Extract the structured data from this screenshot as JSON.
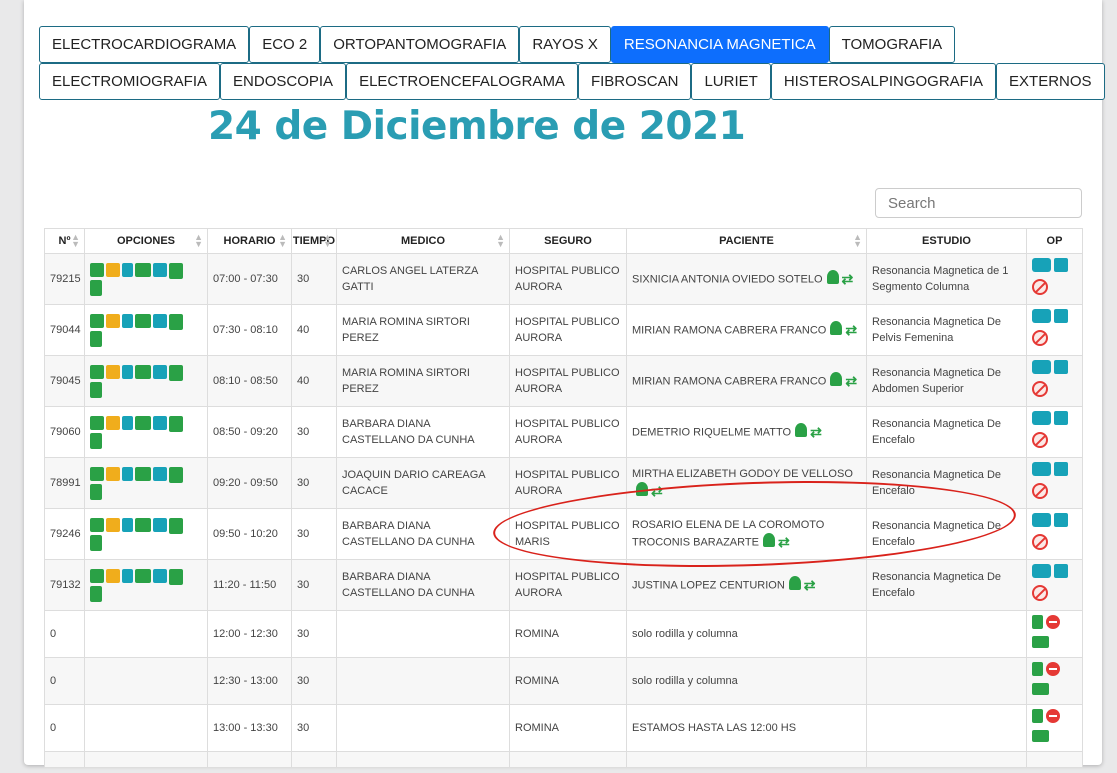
{
  "tabs_row1": [
    "ELECTROCARDIOGRAMA",
    "ECO 2",
    "ORTOPANTOMOGRAFIA",
    "RAYOS X",
    "RESONANCIA MAGNETICA",
    "TOMOGRAFIA"
  ],
  "tabs_row2": [
    "ELECTROMIOGRAFIA",
    "ENDOSCOPIA",
    "ELECTROENCEFALOGRAMA",
    "FIBROSCAN",
    "LURIET",
    "HISTEROSALPINGOGRAFIA",
    "EXTERNOS"
  ],
  "active_tab": "RESONANCIA MAGNETICA",
  "date_title": "24 de Diciembre de 2021",
  "search": {
    "placeholder": "Search"
  },
  "columns": [
    "Nº",
    "OPCIONES",
    "HORARIO",
    "TIEMPO",
    "MEDICO",
    "SEGURO",
    "PACIENTE",
    "ESTUDIO",
    "OP"
  ],
  "rows": [
    {
      "n": "79215",
      "horario": "07:00 - 07:30",
      "tiempo": "30",
      "medico": "CARLOS ANGEL LATERZA GATTI",
      "seguro": "HOSPITAL PUBLICO AURORA",
      "paciente": "SIXNICIA ANTONIA OVIEDO SOTELO",
      "estudio": "Resonancia Magnetica de 1 Segmento Columna"
    },
    {
      "n": "79044",
      "horario": "07:30 - 08:10",
      "tiempo": "40",
      "medico": "MARIA ROMINA SIRTORI PEREZ",
      "seguro": "HOSPITAL PUBLICO AURORA",
      "paciente": "MIRIAN RAMONA CABRERA FRANCO",
      "estudio": "Resonancia Magnetica De Pelvis Femenina"
    },
    {
      "n": "79045",
      "horario": "08:10 - 08:50",
      "tiempo": "40",
      "medico": "MARIA ROMINA SIRTORI PEREZ",
      "seguro": "HOSPITAL PUBLICO AURORA",
      "paciente": "MIRIAN RAMONA CABRERA FRANCO",
      "estudio": "Resonancia Magnetica De Abdomen Superior"
    },
    {
      "n": "79060",
      "horario": "08:50 - 09:20",
      "tiempo": "30",
      "medico": "BARBARA DIANA CASTELLANO DA CUNHA",
      "seguro": "HOSPITAL PUBLICO AURORA",
      "paciente": "DEMETRIO RIQUELME MATTO",
      "estudio": "Resonancia Magnetica De Encefalo"
    },
    {
      "n": "78991",
      "horario": "09:20 - 09:50",
      "tiempo": "30",
      "medico": "JOAQUIN DARIO CAREAGA CACACE",
      "seguro": "HOSPITAL PUBLICO AURORA",
      "paciente": "MIRTHA ELIZABETH GODOY DE VELLOSO",
      "estudio": "Resonancia Magnetica De Encefalo"
    },
    {
      "n": "79246",
      "horario": "09:50 - 10:20",
      "tiempo": "30",
      "medico": "BARBARA DIANA CASTELLANO DA CUNHA",
      "seguro": "HOSPITAL PUBLICO MARIS",
      "paciente": "ROSARIO ELENA DE LA COROMOTO TROCONIS BARAZARTE",
      "estudio": "Resonancia Magnetica De Encefalo"
    },
    {
      "n": "79132",
      "horario": "11:20 - 11:50",
      "tiempo": "30",
      "medico": "BARBARA DIANA CASTELLANO DA CUNHA",
      "seguro": "HOSPITAL PUBLICO AURORA",
      "paciente": "JUSTINA LOPEZ CENTURION",
      "estudio": "Resonancia Magnetica De Encefalo"
    }
  ],
  "free_rows": [
    {
      "n": "0",
      "horario": "12:00 - 12:30",
      "tiempo": "30",
      "seguro": "ROMINA",
      "paciente": "solo rodilla y columna"
    },
    {
      "n": "0",
      "horario": "12:30 - 13:00",
      "tiempo": "30",
      "seguro": "ROMINA",
      "paciente": "solo rodilla y columna"
    },
    {
      "n": "0",
      "horario": "13:00 - 13:30",
      "tiempo": "30",
      "seguro": "ROMINA",
      "paciente": "ESTAMOS HASTA LAS 12:00 HS"
    }
  ]
}
